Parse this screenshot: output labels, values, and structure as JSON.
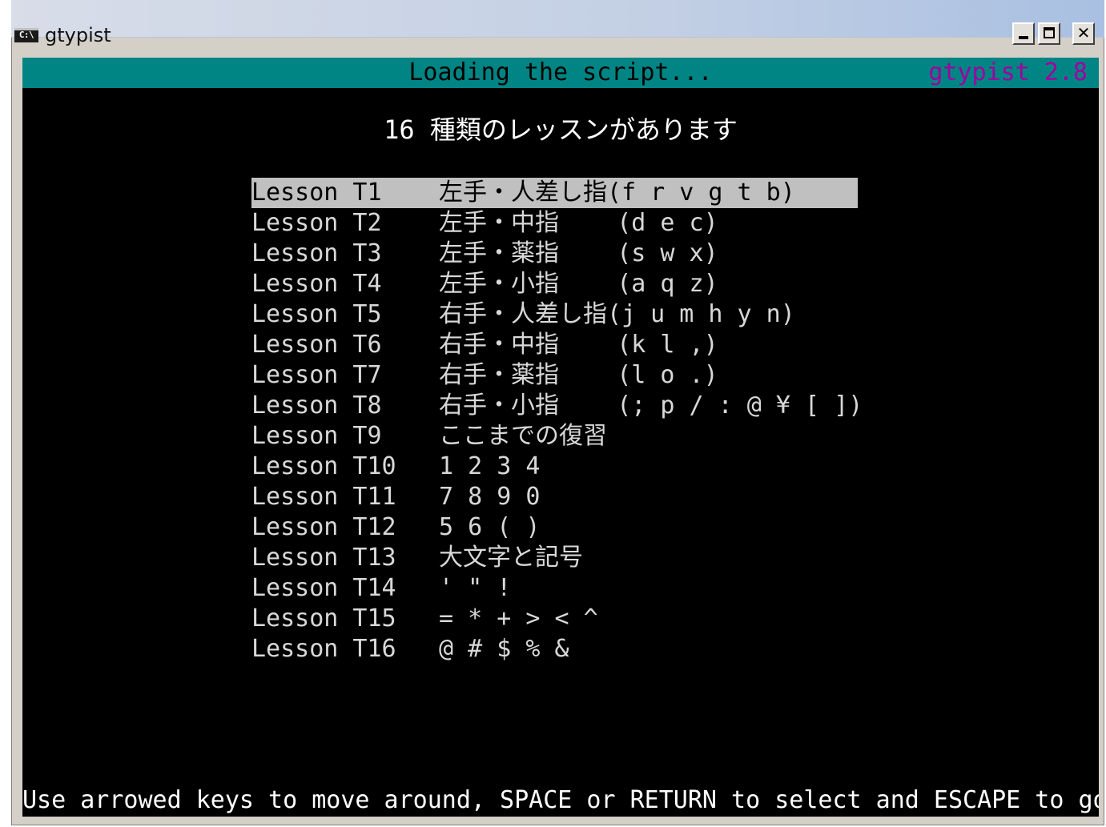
{
  "window": {
    "title": "gtypist",
    "icon_label": "C:\\",
    "controls": {
      "minimize": "minimize",
      "maximize": "maximize",
      "close": "✕"
    }
  },
  "status_bar": {
    "message": "Loading the script...",
    "version": "gtypist 2.8",
    "background_color": "#008484",
    "version_color": "#a000a0"
  },
  "menu": {
    "heading": "16 種類のレッスンがあります",
    "selected_index": 0,
    "items": [
      {
        "name": "Lesson T1",
        "description": "左手・人差し指(f r v g t b)"
      },
      {
        "name": "Lesson T2",
        "description": "左手・中指    (d e c)"
      },
      {
        "name": "Lesson T3",
        "description": "左手・薬指    (s w x)"
      },
      {
        "name": "Lesson T4",
        "description": "左手・小指    (a q z)"
      },
      {
        "name": "Lesson T5",
        "description": "右手・人差し指(j u m h y n)"
      },
      {
        "name": "Lesson T6",
        "description": "右手・中指    (k l ,)"
      },
      {
        "name": "Lesson T7",
        "description": "右手・薬指    (l o .)"
      },
      {
        "name": "Lesson T8",
        "description": "右手・小指    (; p / : @ ¥ [ ])"
      },
      {
        "name": "Lesson T9",
        "description": "ここまでの復習"
      },
      {
        "name": "Lesson T10",
        "description": "1 2 3 4"
      },
      {
        "name": "Lesson T11",
        "description": "7 8 9 0"
      },
      {
        "name": "Lesson T12",
        "description": "5 6 ( )"
      },
      {
        "name": "Lesson T13",
        "description": "大文字と記号"
      },
      {
        "name": "Lesson T14",
        "description": "' \" !"
      },
      {
        "name": "Lesson T15",
        "description": "= * + > < ^"
      },
      {
        "name": "Lesson T16",
        "description": "@ # $ % &"
      }
    ]
  },
  "help_bar": {
    "text": "Use arrowed keys to move around, SPACE or RETURN to select and ESCAPE to go back"
  }
}
